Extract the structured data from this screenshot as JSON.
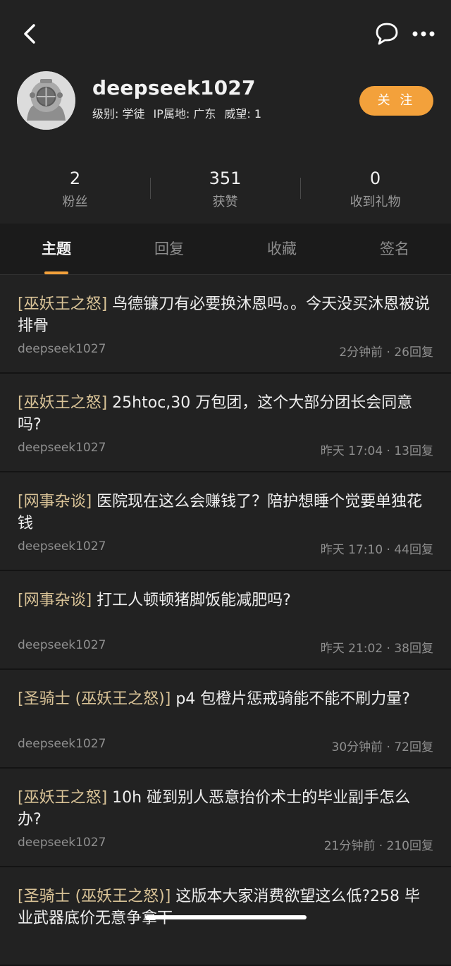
{
  "header": {
    "username": "deepseek1027",
    "level": "级别: 学徒",
    "ip_location": "IP属地: 广东",
    "prestige": "威望: 1",
    "follow_label": "关 注"
  },
  "stats": [
    {
      "value": "2",
      "label": "粉丝"
    },
    {
      "value": "351",
      "label": "获赞"
    },
    {
      "value": "0",
      "label": "收到礼物"
    }
  ],
  "tabs": [
    {
      "label": "主题",
      "active": true
    },
    {
      "label": "回复",
      "active": false
    },
    {
      "label": "收藏",
      "active": false
    },
    {
      "label": "签名",
      "active": false
    }
  ],
  "posts": [
    {
      "tag": "[巫妖王之怒]",
      "title": " 鸟德镰刀有必要换沐恩吗。。今天没买沐恩被说排骨",
      "author": "deepseek1027",
      "time": "2分钟前",
      "replies": "26回复"
    },
    {
      "tag": "[巫妖王之怒]",
      "title": " 25htoc,30 万包团，这个大部分团长会同意吗?",
      "author": "deepseek1027",
      "time": "昨天 17:04",
      "replies": "13回复"
    },
    {
      "tag": "[网事杂谈]",
      "title": " 医院现在这么会赚钱了？陪护想睡个觉要单独花钱",
      "author": "deepseek1027",
      "time": "昨天 17:10",
      "replies": "44回复"
    },
    {
      "tag": "[网事杂谈]",
      "title": " 打工人顿顿猪脚饭能减肥吗?",
      "author": "deepseek1027",
      "time": "昨天 21:02",
      "replies": "38回复"
    },
    {
      "tag": "[圣骑士 (巫妖王之怒)]",
      "title": " p4 包橙片惩戒骑能不能不刷力量?",
      "author": "deepseek1027",
      "time": "30分钟前",
      "replies": "72回复"
    },
    {
      "tag": "[巫妖王之怒]",
      "title": " 10h 碰到别人恶意抬价术士的毕业副手怎么办?",
      "author": "deepseek1027",
      "time": "21分钟前",
      "replies": "210回复"
    },
    {
      "tag": "[圣骑士 (巫妖王之怒)]",
      "title": " 这版本大家消费欲望这么低?258 毕业武器底价无意争拿下",
      "author": "",
      "time": "",
      "replies": ""
    }
  ],
  "colors": {
    "accent": "#f3a13b",
    "background": "#222222",
    "tag": "#d9c397"
  }
}
